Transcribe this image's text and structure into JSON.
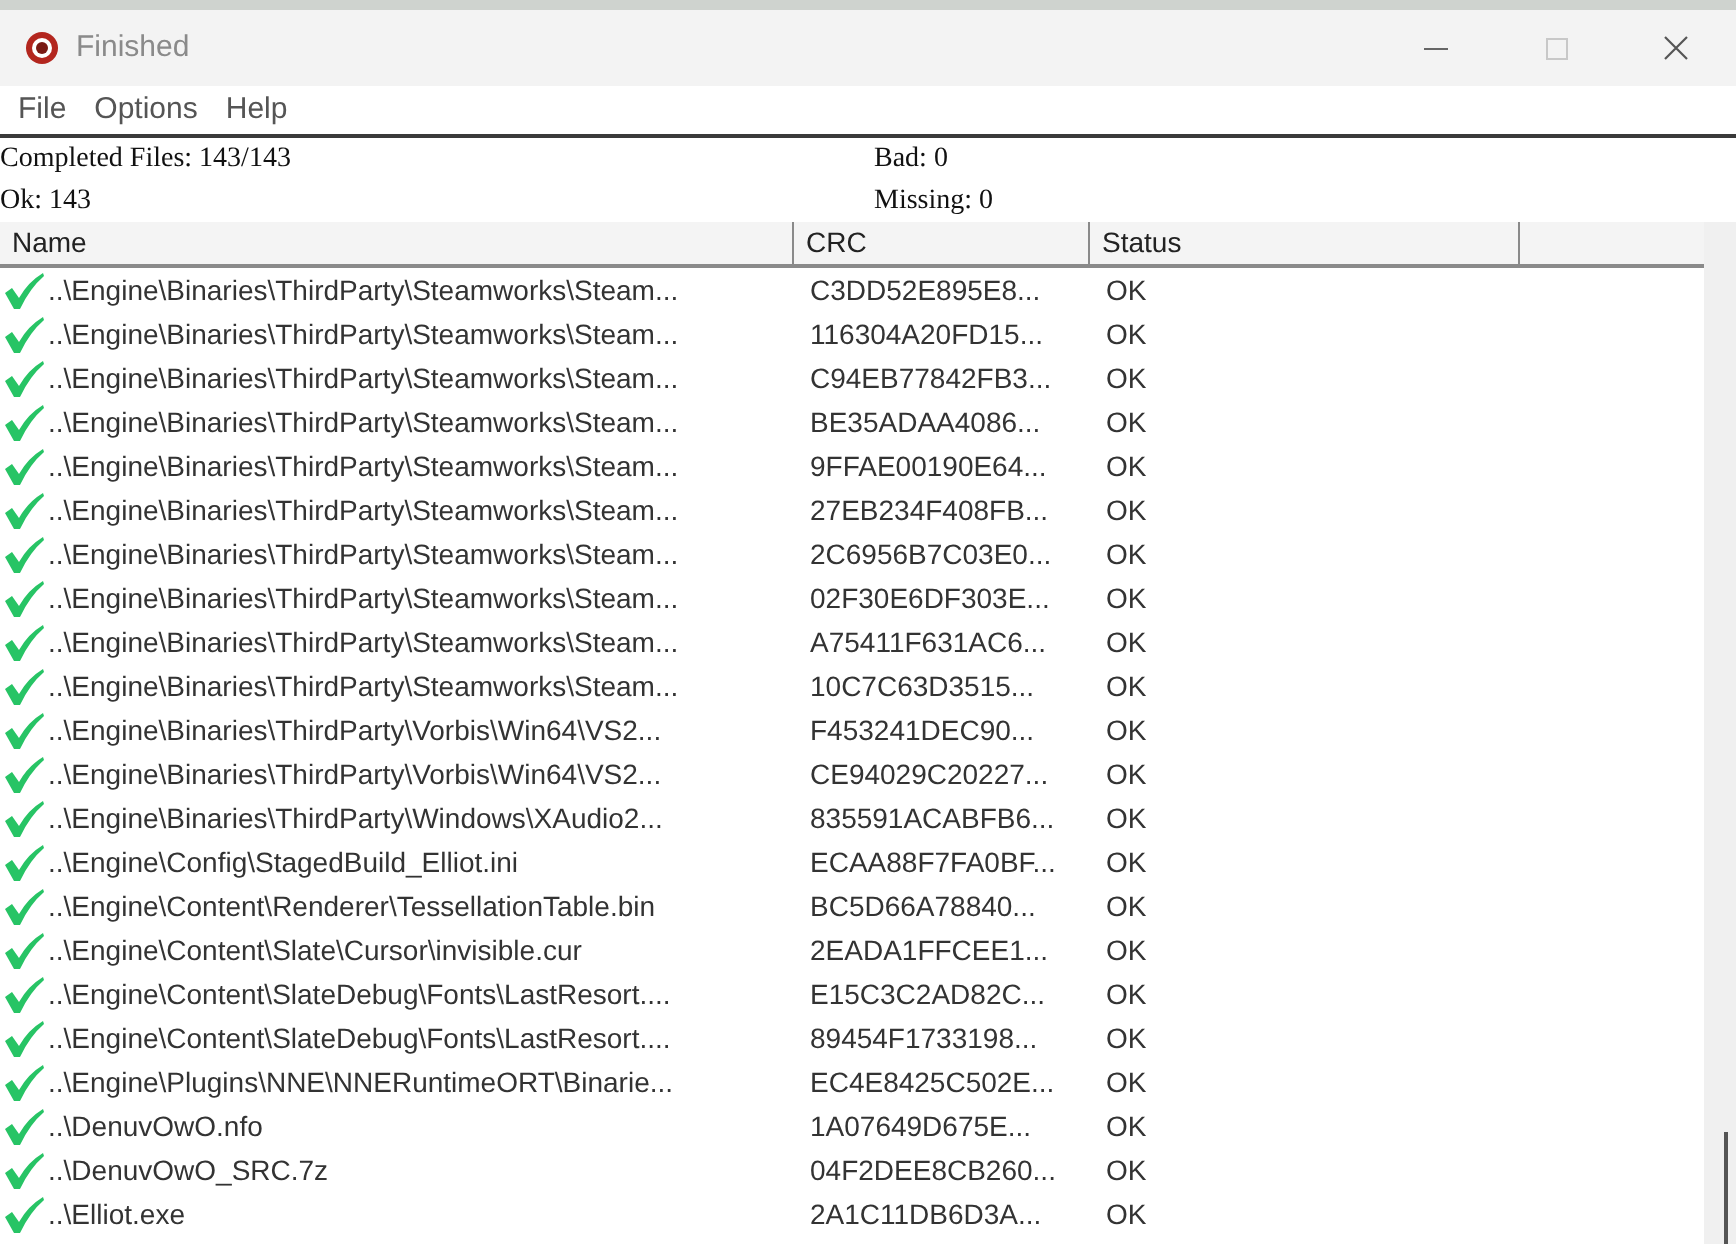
{
  "window": {
    "title": "Finished"
  },
  "menu": [
    "File",
    "Options",
    "Help"
  ],
  "summary": [
    "Completed Files: 143/143",
    "Bad: 0",
    "Ok: 143",
    "Missing: 0"
  ],
  "table": {
    "columns": [
      "Name",
      "CRC",
      "Status"
    ],
    "rows": [
      {
        "name": "..\\Engine\\Binaries\\ThirdParty\\Steamworks\\Steam...",
        "crc": "C3DD52E895E8...",
        "status": "OK",
        "ok": true
      },
      {
        "name": "..\\Engine\\Binaries\\ThirdParty\\Steamworks\\Steam...",
        "crc": "116304A20FD15...",
        "status": "OK",
        "ok": true
      },
      {
        "name": "..\\Engine\\Binaries\\ThirdParty\\Steamworks\\Steam...",
        "crc": "C94EB77842FB3...",
        "status": "OK",
        "ok": true
      },
      {
        "name": "..\\Engine\\Binaries\\ThirdParty\\Steamworks\\Steam...",
        "crc": "BE35ADAA4086...",
        "status": "OK",
        "ok": true
      },
      {
        "name": "..\\Engine\\Binaries\\ThirdParty\\Steamworks\\Steam...",
        "crc": "9FFAE00190E64...",
        "status": "OK",
        "ok": true
      },
      {
        "name": "..\\Engine\\Binaries\\ThirdParty\\Steamworks\\Steam...",
        "crc": "27EB234F408FB...",
        "status": "OK",
        "ok": true
      },
      {
        "name": "..\\Engine\\Binaries\\ThirdParty\\Steamworks\\Steam...",
        "crc": "2C6956B7C03E0...",
        "status": "OK",
        "ok": true
      },
      {
        "name": "..\\Engine\\Binaries\\ThirdParty\\Steamworks\\Steam...",
        "crc": "02F30E6DF303E...",
        "status": "OK",
        "ok": true
      },
      {
        "name": "..\\Engine\\Binaries\\ThirdParty\\Steamworks\\Steam...",
        "crc": "A75411F631AC6...",
        "status": "OK",
        "ok": true
      },
      {
        "name": "..\\Engine\\Binaries\\ThirdParty\\Steamworks\\Steam...",
        "crc": "10C7C63D3515...",
        "status": "OK",
        "ok": true
      },
      {
        "name": "..\\Engine\\Binaries\\ThirdParty\\Vorbis\\Win64\\VS2...",
        "crc": "F453241DEC90...",
        "status": "OK",
        "ok": true
      },
      {
        "name": "..\\Engine\\Binaries\\ThirdParty\\Vorbis\\Win64\\VS2...",
        "crc": "CE94029C20227...",
        "status": "OK",
        "ok": true
      },
      {
        "name": "..\\Engine\\Binaries\\ThirdParty\\Windows\\XAudio2...",
        "crc": "835591ACABFB6...",
        "status": "OK",
        "ok": true
      },
      {
        "name": "..\\Engine\\Config\\StagedBuild_Elliot.ini",
        "crc": "ECAA88F7FA0BF...",
        "status": "OK",
        "ok": true
      },
      {
        "name": "..\\Engine\\Content\\Renderer\\TessellationTable.bin",
        "crc": "BC5D66A78840...",
        "status": "OK",
        "ok": true
      },
      {
        "name": "..\\Engine\\Content\\Slate\\Cursor\\invisible.cur",
        "crc": "2EADA1FFCEE1...",
        "status": "OK",
        "ok": true
      },
      {
        "name": "..\\Engine\\Content\\SlateDebug\\Fonts\\LastResort....",
        "crc": "E15C3C2AD82C...",
        "status": "OK",
        "ok": true
      },
      {
        "name": "..\\Engine\\Content\\SlateDebug\\Fonts\\LastResort....",
        "crc": "89454F1733198...",
        "status": "OK",
        "ok": true
      },
      {
        "name": "..\\Engine\\Plugins\\NNE\\NNERuntimeORT\\Binarie...",
        "crc": "EC4E8425C502E...",
        "status": "OK",
        "ok": true
      },
      {
        "name": "..\\DenuvOwO.nfo",
        "crc": "1A07649D675E...",
        "status": "OK",
        "ok": true
      },
      {
        "name": "..\\DenuvOwO_SRC.7z",
        "crc": "04F2DEE8CB260...",
        "status": "OK",
        "ok": true
      },
      {
        "name": "..\\Elliot.exe",
        "crc": "2A1C11DB6D3A...",
        "status": "OK",
        "ok": true
      }
    ]
  }
}
